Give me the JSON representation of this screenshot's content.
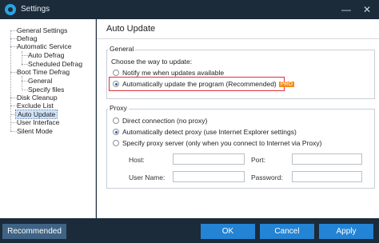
{
  "window": {
    "title": "Settings",
    "minimize": "—",
    "close": "✕"
  },
  "sidebar": {
    "items": [
      {
        "label": "General Settings"
      },
      {
        "label": "Defrag"
      },
      {
        "label": "Automatic Service"
      },
      {
        "label": "Auto Defrag"
      },
      {
        "label": "Scheduled Defrag"
      },
      {
        "label": "Boot Time Defrag"
      },
      {
        "label": "General"
      },
      {
        "label": "Specify files"
      },
      {
        "label": "Disk Cleanup"
      },
      {
        "label": "Exclude List"
      },
      {
        "label": "Auto Update"
      },
      {
        "label": "User Interface"
      },
      {
        "label": "Silent Mode"
      }
    ],
    "selected": "Auto Update"
  },
  "content": {
    "title": "Auto Update",
    "general": {
      "label": "General",
      "prompt": "Choose the way to update:",
      "options": [
        {
          "label": "Notify me when updates available",
          "checked": false
        },
        {
          "label": "Automatically update the program (Recommended)",
          "checked": true,
          "badge": "PRO"
        }
      ]
    },
    "proxy": {
      "label": "Proxy",
      "options": [
        {
          "label": "Direct connection (no proxy)",
          "checked": false
        },
        {
          "label": "Automatically detect proxy (use Internet Explorer settings)",
          "checked": true
        },
        {
          "label": "Specify proxy server (only when you connect to Internet via Proxy)",
          "checked": false
        }
      ],
      "fields": {
        "host_label": "Host:",
        "port_label": "Port:",
        "user_label": "User Name:",
        "password_label": "Password:",
        "host": "",
        "port": "",
        "user": "",
        "password": ""
      }
    }
  },
  "footer": {
    "recommended": "Recommended",
    "ok": "OK",
    "cancel": "Cancel",
    "apply": "Apply"
  },
  "colors": {
    "titlebar": "#1b2b3a",
    "button_blue": "#2383d4",
    "pro_badge": "#f28c1a",
    "highlight": "#e0303a"
  }
}
